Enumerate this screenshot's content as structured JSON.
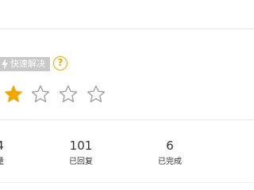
{
  "badge": {
    "icon": "bolt-icon",
    "label": "快速解决"
  },
  "help_icon": {
    "icon": "question-circle-icon",
    "glyph": "?"
  },
  "rating": {
    "filled": 1,
    "total": 5,
    "star_color": "#f2a600",
    "empty_color": "#9a9a9a"
  },
  "stats": [
    {
      "value": "4",
      "label": "量"
    },
    {
      "value": "101",
      "label": "已回复"
    },
    {
      "value": "6",
      "label": "已完成"
    }
  ],
  "colors": {
    "badge_bg": "#c9c9c9",
    "accent": "#f2a600",
    "divider": "#e6e6e6"
  }
}
